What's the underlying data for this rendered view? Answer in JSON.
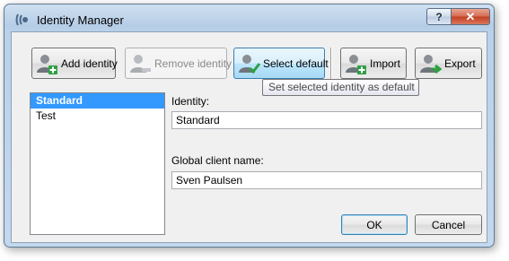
{
  "window": {
    "title": "Identity Manager"
  },
  "caption": {
    "help": "?",
    "close": "✕"
  },
  "toolbar": {
    "add_identity": "Add identity",
    "remove_identity": "Remove identity",
    "select_default": "Select default",
    "import": "Import",
    "export": "Export"
  },
  "tooltip": "Set selected identity as default",
  "identities": {
    "items": [
      {
        "label": "Standard",
        "selected": true
      },
      {
        "label": "Test",
        "selected": false
      }
    ]
  },
  "form": {
    "identity_label": "Identity:",
    "identity_value": "Standard",
    "client_name_label": "Global client name:",
    "client_name_value": "Sven Paulsen"
  },
  "buttons": {
    "ok": "OK",
    "cancel": "Cancel"
  },
  "colors": {
    "selection": "#3399ff",
    "accent_green": "#2ea043",
    "close_red": "#c33f1f"
  },
  "icons": {
    "app": "app-icon",
    "add": "user-add-icon",
    "remove": "user-remove-icon",
    "select_default": "user-check-icon",
    "import": "import-icon",
    "export": "export-icon"
  }
}
